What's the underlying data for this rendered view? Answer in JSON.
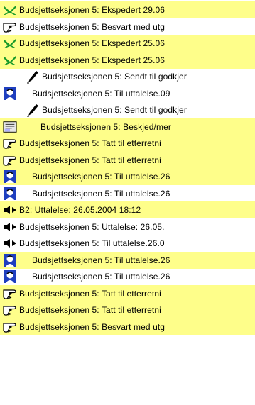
{
  "items": [
    {
      "text": "Budsjettseksjonen 5: Ekspedert 29.06",
      "icon": "check-icon",
      "highlight": true,
      "indent": 4,
      "labelOffset": 0
    },
    {
      "text": "Budsjettseksjonen 5: Besvart med utg",
      "icon": "pointing-hand-icon",
      "highlight": false,
      "indent": 4,
      "labelOffset": 0
    },
    {
      "text": "Budsjettseksjonen 5: Ekspedert 25.06",
      "icon": "check-icon",
      "highlight": true,
      "indent": 4,
      "labelOffset": 0
    },
    {
      "text": "Budsjettseksjonen 5: Ekspedert 25.06",
      "icon": "check-icon",
      "highlight": true,
      "indent": 4,
      "labelOffset": 0
    },
    {
      "text": "Budsjettseksjonen 5: Sendt til godkjer",
      "icon": "pen-icon",
      "highlight": false,
      "indent": 36,
      "labelOffset": 0
    },
    {
      "text": "Budsjettseksjonen 5: Til uttalelse.09",
      "icon": "person-icon",
      "highlight": false,
      "indent": 4,
      "labelOffset": 18
    },
    {
      "text": "Budsjettseksjonen 5: Sendt til godkjer",
      "icon": "pen-icon",
      "highlight": false,
      "indent": 36,
      "labelOffset": 0
    },
    {
      "text": "Budsjettseksjonen 5: Beskjed/mer",
      "icon": "note-icon",
      "highlight": true,
      "indent": 4,
      "labelOffset": 30
    },
    {
      "text": "Budsjettseksjonen 5: Tatt til etterretni",
      "icon": "pointing-hand-icon",
      "highlight": true,
      "indent": 4,
      "labelOffset": 0
    },
    {
      "text": "Budsjettseksjonen 5: Tatt til etterretni",
      "icon": "pointing-hand-icon",
      "highlight": true,
      "indent": 4,
      "labelOffset": 0
    },
    {
      "text": "Budsjettseksjonen 5: Til uttalelse.26",
      "icon": "person-icon",
      "highlight": true,
      "indent": 4,
      "labelOffset": 18
    },
    {
      "text": "Budsjettseksjonen 5: Til uttalelse.26",
      "icon": "person-icon",
      "highlight": false,
      "indent": 4,
      "labelOffset": 18
    },
    {
      "text": "B2: Uttalelse: 26.05.2004 18:12",
      "icon": "speaker-arrow-icon",
      "highlight": true,
      "indent": 4,
      "labelOffset": 0
    },
    {
      "text": "Budsjettseksjonen 5: Uttalelse: 26.05.",
      "icon": "speaker-arrow-icon",
      "highlight": false,
      "indent": 4,
      "labelOffset": 0
    },
    {
      "text": "Budsjettseksjonen 5: Til uttalelse.26.0",
      "icon": "speaker-arrow-icon",
      "highlight": false,
      "indent": 4,
      "labelOffset": 0
    },
    {
      "text": "Budsjettseksjonen 5: Til uttalelse.26",
      "icon": "person-icon",
      "highlight": true,
      "indent": 4,
      "labelOffset": 18
    },
    {
      "text": "Budsjettseksjonen 5: Til uttalelse.26",
      "icon": "person-icon",
      "highlight": false,
      "indent": 4,
      "labelOffset": 18
    },
    {
      "text": "Budsjettseksjonen 5: Tatt til etterretni",
      "icon": "pointing-hand-icon",
      "highlight": true,
      "indent": 4,
      "labelOffset": 0
    },
    {
      "text": "Budsjettseksjonen 5: Tatt til etterretni",
      "icon": "pointing-hand-icon",
      "highlight": true,
      "indent": 4,
      "labelOffset": 0
    },
    {
      "text": "Budsjettseksjonen 5: Besvart med utg",
      "icon": "pointing-hand-icon",
      "highlight": true,
      "indent": 4,
      "labelOffset": 0
    }
  ],
  "colors": {
    "highlight": "#fefe8a",
    "check": "#1a9a2a",
    "person": "#1f3fbf"
  }
}
